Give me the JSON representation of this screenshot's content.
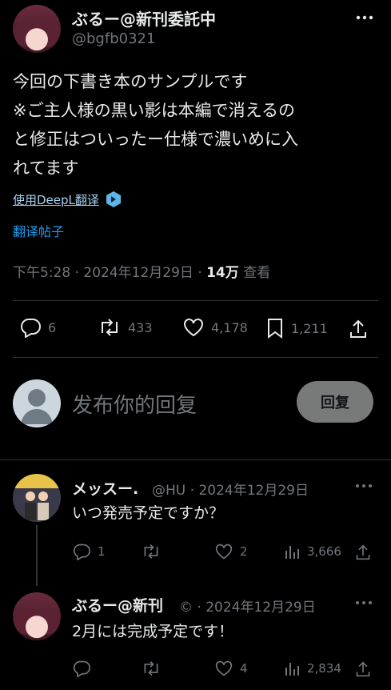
{
  "tweet": {
    "author_name": "ぶるー@新刊委託中",
    "handle": "@bgfb0321",
    "text_lines": [
      "今回の下書き本のサンプルです",
      "※ご主人様の黒い影は本編で消えるの",
      "と修正はついったー仕様で濃いめに入",
      "れてます"
    ],
    "translate_deepl": "使用DeepL翻译",
    "translate_post": "翻译帖子",
    "time": "下午5:28 · 2024年12月29日 · ",
    "views": "14万",
    "views_label": " 查看",
    "stats": {
      "replies": "6",
      "retweets": "433",
      "likes": "4,178",
      "bookmarks": "1,211"
    }
  },
  "composer": {
    "placeholder": "发布你的回复",
    "reply_button": "回复"
  },
  "replies": [
    {
      "name": "メッスー.",
      "meta": "@HU · 2024年12月29日",
      "text": "いつ発売予定ですか？",
      "stats": {
        "replies": "1",
        "retweets": "",
        "likes": "2",
        "views": "3,666"
      }
    },
    {
      "name": "ぶるー@新刊",
      "meta": "© · 2024年12月29日",
      "text": "2月には完成予定です！",
      "stats": {
        "replies": "",
        "retweets": "",
        "likes": "4",
        "views": "2,834"
      }
    }
  ],
  "colors": {
    "background": "#000000",
    "text": "#e7e9ea",
    "muted": "#71767b",
    "link": "#1d9bf0",
    "divider": "#2f3336"
  }
}
